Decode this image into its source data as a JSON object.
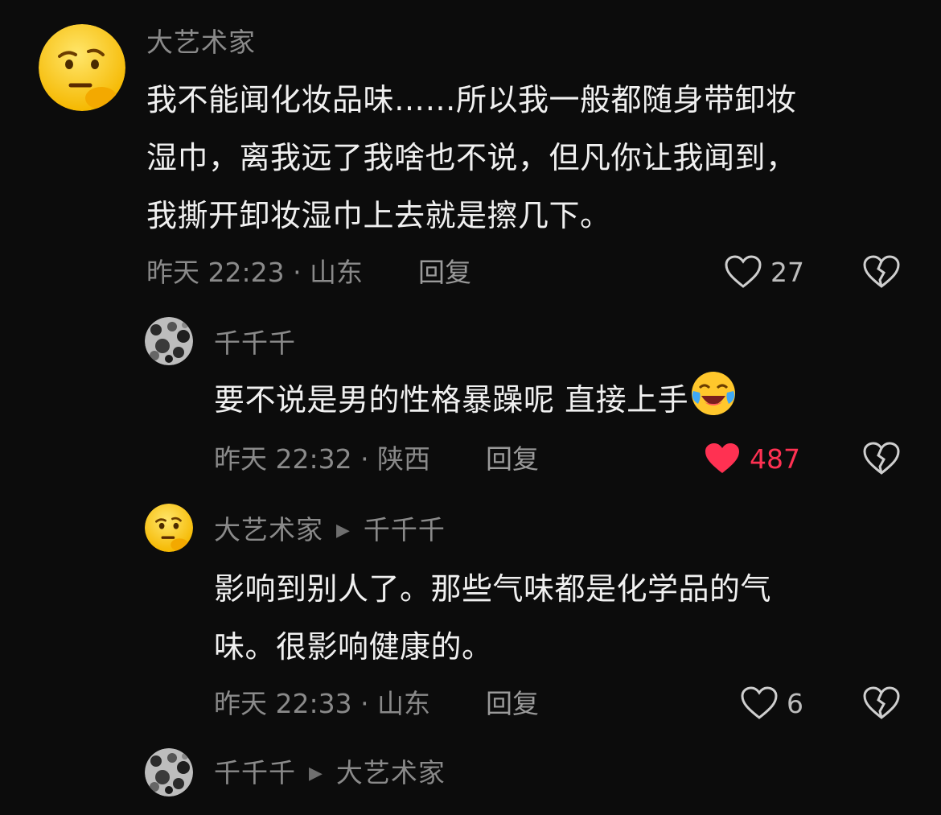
{
  "comments": [
    {
      "username": "大艺术家",
      "reply_to": "",
      "text_lines": [
        "我不能闻化妆品味……所以我一般都随身带卸妆",
        "湿巾，离我远了我啥也不说，但凡你让我闻到，",
        "我撕开卸妆湿巾上去就是擦几下。"
      ],
      "time_location": "昨天 22:23 · 山东",
      "reply_label": "回复",
      "likes": "27",
      "liked": false,
      "avatar_icon": "thinking-face-icon"
    },
    {
      "username": "千千千",
      "reply_to": "",
      "text_lines": [
        "要不说是男的性格暴躁呢 直接上手"
      ],
      "time_location": "昨天 22:32 · 陕西",
      "reply_label": "回复",
      "likes": "487",
      "liked": true,
      "avatar_icon": "grayscale-pattern-avatar",
      "inline_emoji": "crying-laughing-face-icon"
    },
    {
      "username": "大艺术家",
      "reply_to": "千千千",
      "text_lines": [
        "影响到别人了。那些气味都是化学品的气",
        "味。很影响健康的。"
      ],
      "time_location": "昨天 22:33 · 山东",
      "reply_label": "回复",
      "likes": "6",
      "liked": false,
      "avatar_icon": "thinking-face-icon"
    },
    {
      "username": "千千千",
      "reply_to": "大艺术家",
      "avatar_icon": "grayscale-pattern-avatar"
    }
  ],
  "colors": {
    "background": "#0c0c0c",
    "like_active": "#ff3152",
    "secondary_text": "#8a8a8a"
  }
}
